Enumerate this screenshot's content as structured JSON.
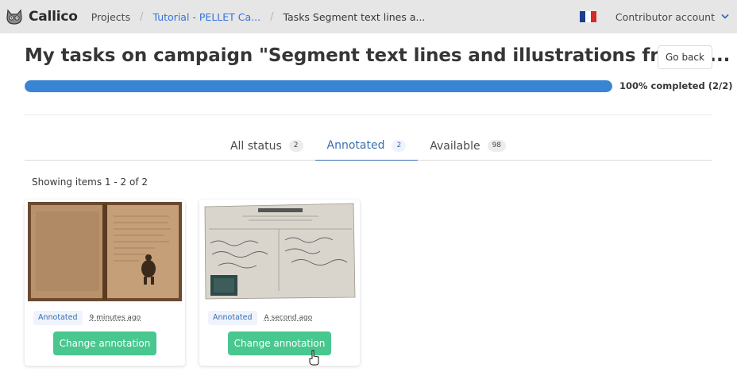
{
  "app": {
    "name": "Callico",
    "logo_icon": "cat-logo-icon"
  },
  "breadcrumbs": [
    {
      "label": "Projects"
    },
    {
      "label": "Tutorial - PELLET Ca..."
    },
    {
      "label": "Tasks Segment text lines a..."
    }
  ],
  "nav": {
    "language_icon": "french-flag-icon",
    "account_label": "Contributor account"
  },
  "colors": {
    "accent": "#3a6fb0",
    "progress": "#3a85d3",
    "success": "#48c78e"
  },
  "header": {
    "title": "My tasks on campaign \"Segment text lines and illustrations from p...",
    "go_back_label": "Go back"
  },
  "progress": {
    "percent": 100,
    "label": "100% completed (2/2)"
  },
  "tabs": [
    {
      "label": "All status",
      "count": "2"
    },
    {
      "label": "Annotated",
      "count": "2",
      "active": true
    },
    {
      "label": "Available",
      "count": "98"
    }
  ],
  "listing": {
    "showing_text": "Showing items 1 - 2 of 2"
  },
  "cards": [
    {
      "status": "Annotated",
      "time": "9 minutes ago",
      "button_label": "Change annotation"
    },
    {
      "status": "Annotated",
      "time": "A second ago",
      "button_label": "Change annotation"
    }
  ]
}
